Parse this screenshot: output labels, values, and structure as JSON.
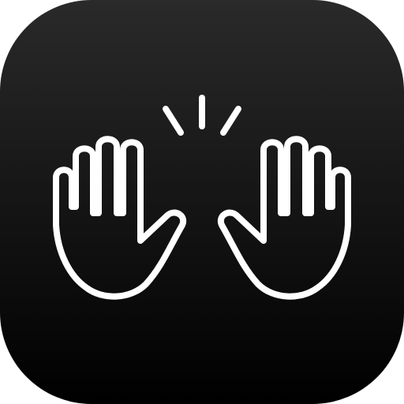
{
  "app_icon": {
    "icon_name": "raising-hands-icon",
    "background_top": "#2a2a2a",
    "background_bottom": "#000000",
    "glyph_color": "#ffffff"
  }
}
